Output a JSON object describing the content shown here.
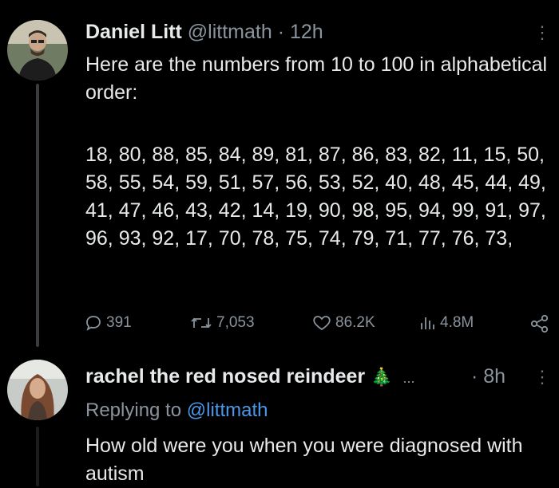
{
  "tweet1": {
    "author_name": "Daniel Litt",
    "handle": "@littmath",
    "separator": "·",
    "time": "12h",
    "more": "⋮",
    "text_intro": "Here are the numbers from 10 to 100 in alphabetical order:",
    "text_numbers": "18, 80, 88, 85, 84, 89, 81, 87, 86, 83, 82, 11, 15, 50, 58, 55, 54, 59, 51, 57, 56, 53, 52, 40, 48, 45, 44, 49, 41, 47, 46, 43, 42, 14, 19, 90, 98, 95, 94, 99, 91, 97, 96, 93, 92, 17, 70, 78, 75, 74, 79, 71, 77, 76, 73,",
    "stats": {
      "replies": "391",
      "reposts": "7,053",
      "likes": "86.2K",
      "views": "4.8M"
    },
    "icons": [
      "reply-icon",
      "repost-icon",
      "like-icon",
      "views-icon",
      "share-icon"
    ]
  },
  "tweet2": {
    "author_name": "rachel the red nosed reindeer",
    "emoji": "🎄",
    "ellipsis": "...",
    "separator": "·",
    "time": "8h",
    "more": "⋮",
    "replying_prefix": "Replying to",
    "replying_handle": "@littmath",
    "text": "How old were you when you were diagnosed with autism"
  },
  "colors": {
    "background": "#000000",
    "text": "#e7e9ea",
    "muted": "#8b949c",
    "link": "#4a99e9",
    "thread_line": "#3a3d40"
  }
}
